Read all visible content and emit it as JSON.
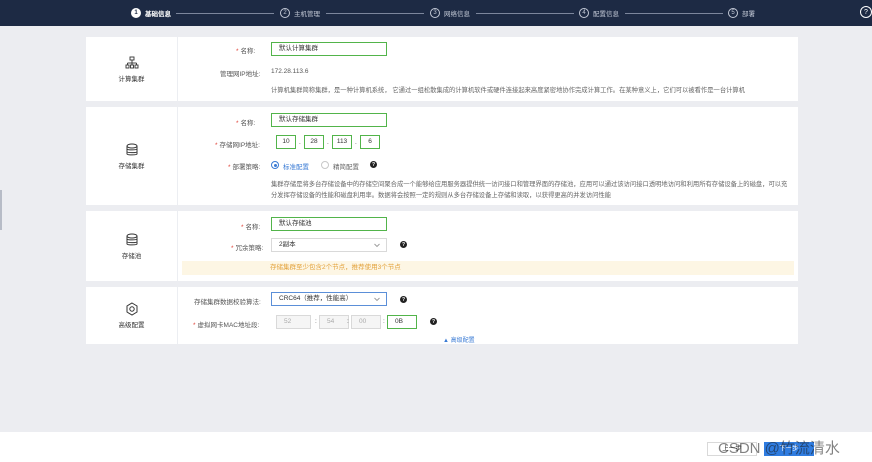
{
  "wizard": {
    "steps": [
      {
        "num": "1",
        "label": "基础信息",
        "active": true
      },
      {
        "num": "2",
        "label": "主机管理",
        "active": false
      },
      {
        "num": "3",
        "label": "网络信息",
        "active": false
      },
      {
        "num": "4",
        "label": "配置信息",
        "active": false
      },
      {
        "num": "5",
        "label": "部署",
        "active": false
      }
    ],
    "help_glyph": "?"
  },
  "compute_cluster": {
    "title": "计算集群",
    "icon": "network-tree-icon",
    "name_label": "名称:",
    "name_value": "默认计算集群",
    "mgmt_ip_label": "管理网IP地址:",
    "mgmt_ip_value": "172.28.113.6",
    "description": "计算机集群简称集群，是一种计算机系统， 它通过一组松散集成的计算机软件或硬件连接起来高度紧密地协作完成计算工作。在某种意义上，它们可以被看作是一台计算机"
  },
  "storage_cluster": {
    "title": "存储集群",
    "icon": "database-icon",
    "name_label": "名称:",
    "name_value": "默认存储集群",
    "ip_label": "存储网IP地址:",
    "ip_octets": [
      "10",
      "28",
      "113",
      "6"
    ],
    "ip_separator": ".",
    "deploy_label": "部署策略:",
    "deploy_options": [
      "标准配置",
      "精简配置"
    ],
    "deploy_selected": "标准配置",
    "description": "集群存储是将多台存储设备中的存储空间聚合成一个能够给应用服务器提供统一访问接口和管理界面的存储池，应用可以通过该访问接口透明地访问和利用所有存储设备上的磁盘，可以充分发挥存储设备的性能和磁盘利用率。数据将会按照一定的规则从多台存储设备上存储和读取，以获得更高的并发访问性能"
  },
  "storage_pool": {
    "title": "存储池",
    "icon": "database-icon",
    "name_label": "名称:",
    "name_value": "默认存储池",
    "redundancy_label": "冗余策略:",
    "redundancy_value": "2副本",
    "warning": "存储集群至少包含2个节点，推荐使用3个节点"
  },
  "advanced": {
    "title": "高级配置",
    "icon": "gear-icon",
    "checksum_label": "存储集群数据校验算法:",
    "checksum_value": "CRC64（推荐，性能高）",
    "mac_label": "虚拟网卡MAC地址段:",
    "mac_parts": [
      "52",
      "54",
      "00",
      "0B"
    ],
    "mac_separator": ":",
    "toggle_label": "▲ 高级配置"
  },
  "footer": {
    "prev_label": "上一步",
    "next_label": "下一步"
  },
  "watermark": "CSDN @竹流清水",
  "colors": {
    "header_bg": "#1d2a44",
    "accent": "#3a7bd5",
    "valid_border": "#52b44a",
    "required": "#e0443a",
    "warning_bg": "#fdf6e4",
    "warning_text": "#e3a23b"
  }
}
